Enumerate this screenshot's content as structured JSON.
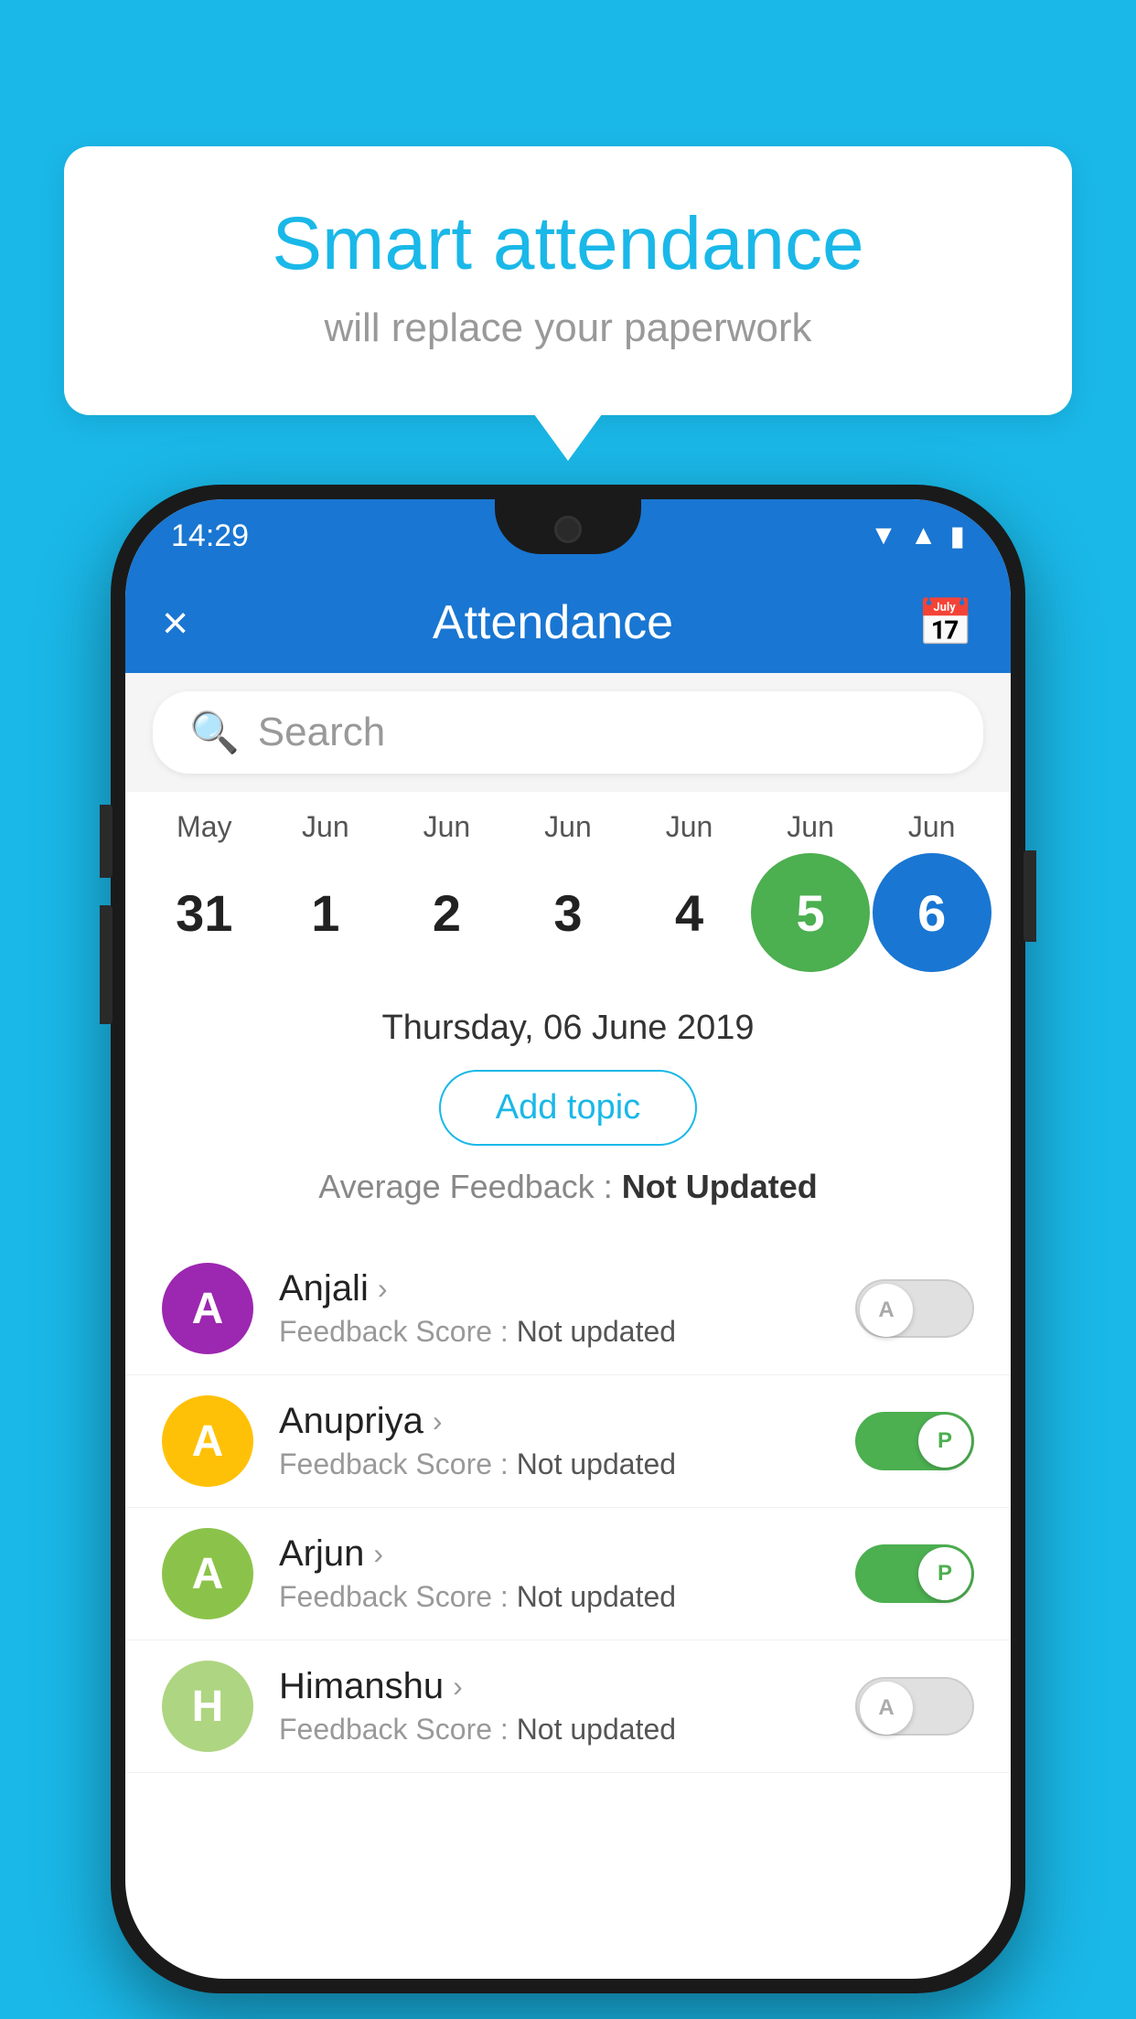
{
  "background_color": "#1ab8e8",
  "bubble": {
    "title": "Smart attendance",
    "subtitle": "will replace your paperwork"
  },
  "phone": {
    "status_bar": {
      "time": "14:29",
      "icons": [
        "wifi",
        "signal",
        "battery"
      ]
    },
    "app_bar": {
      "close_label": "×",
      "title": "Attendance",
      "calendar_icon": "📅"
    },
    "search": {
      "placeholder": "Search"
    },
    "calendar": {
      "months": [
        "May",
        "Jun",
        "Jun",
        "Jun",
        "Jun",
        "Jun",
        "Jun"
      ],
      "dates": [
        "31",
        "1",
        "2",
        "3",
        "4",
        "5",
        "6"
      ],
      "states": [
        "normal",
        "normal",
        "normal",
        "normal",
        "normal",
        "today",
        "selected"
      ]
    },
    "selected_date": "Thursday, 06 June 2019",
    "add_topic_label": "Add topic",
    "avg_feedback_label": "Average Feedback :",
    "avg_feedback_value": "Not Updated",
    "students": [
      {
        "name": "Anjali",
        "avatar_letter": "A",
        "avatar_color": "#9c27b0",
        "feedback_label": "Feedback Score :",
        "feedback_value": "Not updated",
        "toggle": "off",
        "toggle_letter": "A"
      },
      {
        "name": "Anupriya",
        "avatar_letter": "A",
        "avatar_color": "#ffc107",
        "feedback_label": "Feedback Score :",
        "feedback_value": "Not updated",
        "toggle": "on",
        "toggle_letter": "P"
      },
      {
        "name": "Arjun",
        "avatar_letter": "A",
        "avatar_color": "#8bc34a",
        "feedback_label": "Feedback Score :",
        "feedback_value": "Not updated",
        "toggle": "on",
        "toggle_letter": "P"
      },
      {
        "name": "Himanshu",
        "avatar_letter": "H",
        "avatar_color": "#aed581",
        "feedback_label": "Feedback Score :",
        "feedback_value": "Not updated",
        "toggle": "off",
        "toggle_letter": "A"
      }
    ]
  }
}
